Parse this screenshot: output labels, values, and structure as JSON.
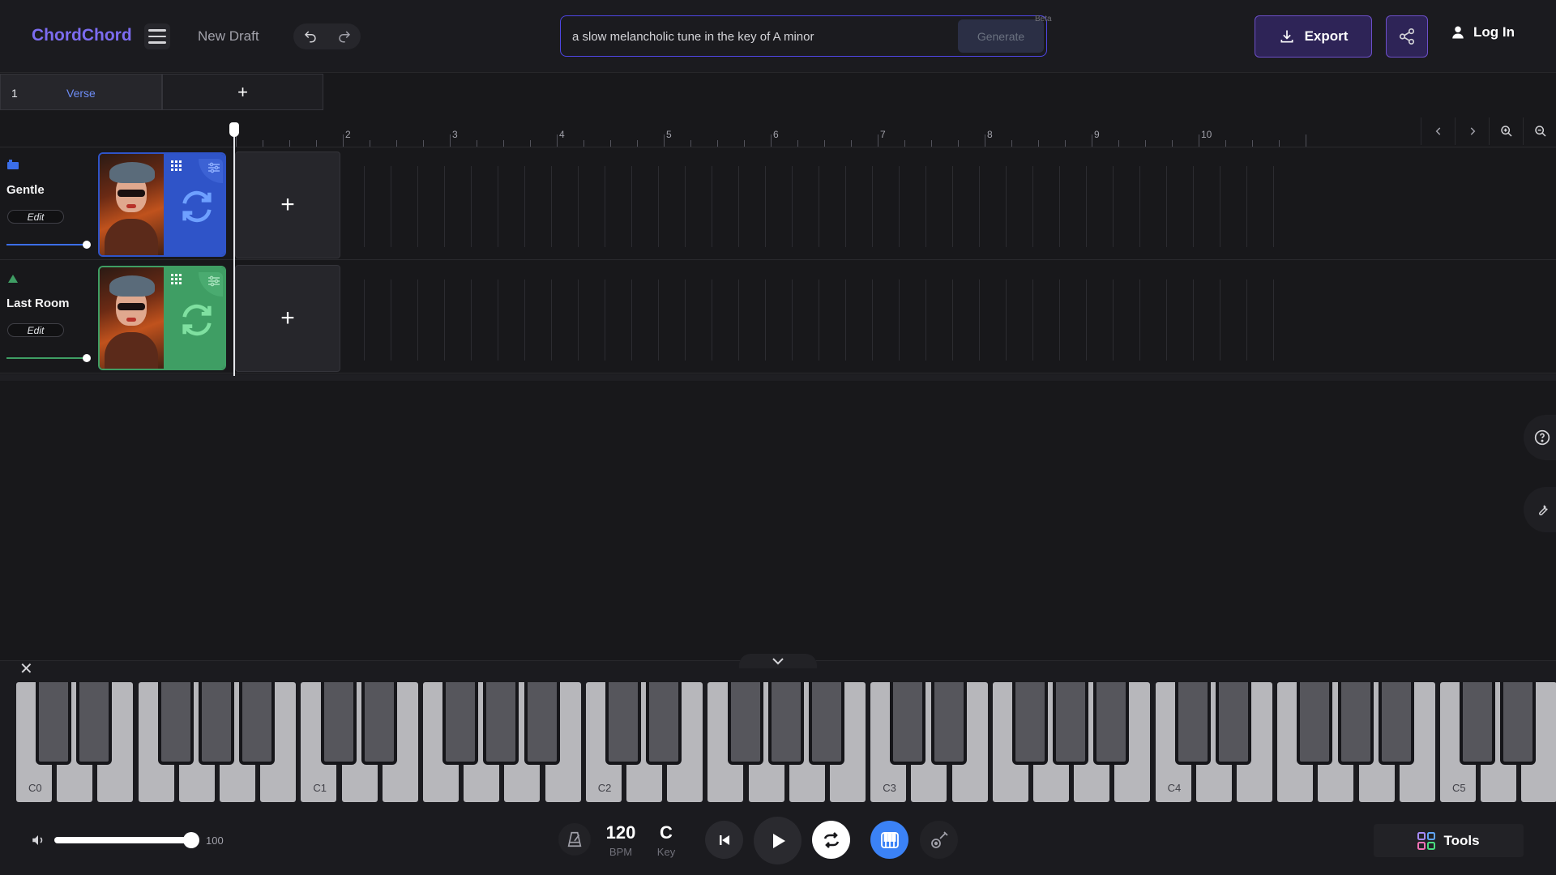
{
  "app": {
    "title": "ChordChord",
    "draft_name": "New Draft"
  },
  "prompt": {
    "value": "a slow melancholic tune in the key of A minor",
    "generate_label": "Generate",
    "beta_label": "Beta"
  },
  "header": {
    "export_label": "Export",
    "login_label": "Log In"
  },
  "sections": [
    {
      "number": "1",
      "name": "Verse"
    }
  ],
  "ruler": {
    "bars": [
      "2",
      "3",
      "4",
      "5",
      "6",
      "7",
      "8",
      "9",
      "10"
    ]
  },
  "tracks": [
    {
      "name": "Gentle",
      "edit_label": "Edit",
      "color": "#2f54c8",
      "accent": "#1e3a8a",
      "volume": 1.0
    },
    {
      "name": "Last Room",
      "edit_label": "Edit",
      "color": "#3f9e64",
      "accent": "#2d6b47",
      "volume": 1.0
    }
  ],
  "piano": {
    "octave_labels": [
      "C0",
      "C1",
      "C2",
      "C3",
      "C4",
      "C5"
    ]
  },
  "transport": {
    "volume": "100",
    "bpm": "120",
    "bpm_label": "BPM",
    "key": "C",
    "key_label": "Key",
    "tools_label": "Tools"
  },
  "colors": {
    "brand": "#7c6cf0",
    "active_instrument": "#3b82f6"
  }
}
